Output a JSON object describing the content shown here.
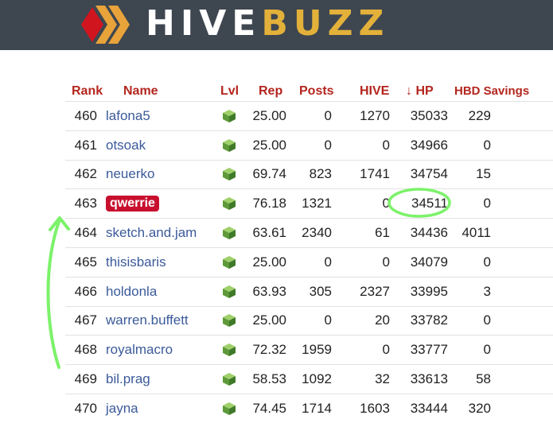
{
  "brand": {
    "part1": "HIVE",
    "part2": "BUZZ"
  },
  "columns": {
    "rank": "Rank",
    "name": "Name",
    "lvl": "Lvl",
    "rep": "Rep",
    "posts": "Posts",
    "hive": "HIVE",
    "sort_arrow": "↓",
    "hp": "HP",
    "hbd_savings": "HBD Savings"
  },
  "rows": [
    {
      "rank": "460",
      "name": "lafona5",
      "rep": "25.00",
      "posts": "0",
      "hive": "1270",
      "hp": "35033",
      "hbd": "229"
    },
    {
      "rank": "461",
      "name": "otsoak",
      "rep": "25.00",
      "posts": "0",
      "hive": "0",
      "hp": "34966",
      "hbd": "0"
    },
    {
      "rank": "462",
      "name": "neuerko",
      "rep": "69.74",
      "posts": "823",
      "hive": "1741",
      "hp": "34754",
      "hbd": "15"
    },
    {
      "rank": "463",
      "name": "qwerrie",
      "rep": "76.18",
      "posts": "1321",
      "hive": "0",
      "hp": "34511",
      "hbd": "0",
      "highlighted": true
    },
    {
      "rank": "464",
      "name": "sketch.and.jam",
      "rep": "63.61",
      "posts": "2340",
      "hive": "61",
      "hp": "34436",
      "hbd": "4011"
    },
    {
      "rank": "465",
      "name": "thisisbaris",
      "rep": "25.00",
      "posts": "0",
      "hive": "0",
      "hp": "34079",
      "hbd": "0"
    },
    {
      "rank": "466",
      "name": "holdonla",
      "rep": "63.93",
      "posts": "305",
      "hive": "2327",
      "hp": "33995",
      "hbd": "3"
    },
    {
      "rank": "467",
      "name": "warren.buffett",
      "rep": "25.00",
      "posts": "0",
      "hive": "20",
      "hp": "33782",
      "hbd": "0"
    },
    {
      "rank": "468",
      "name": "royalmacro",
      "rep": "72.32",
      "posts": "1959",
      "hive": "0",
      "hp": "33777",
      "hbd": "0"
    },
    {
      "rank": "469",
      "name": "bil.prag",
      "rep": "58.53",
      "posts": "1092",
      "hive": "32",
      "hp": "33613",
      "hbd": "58"
    },
    {
      "rank": "470",
      "name": "jayna",
      "rep": "74.45",
      "posts": "1714",
      "hive": "1603",
      "hp": "33444",
      "hbd": "320"
    }
  ],
  "icons": {
    "level": "green-cube-level-icon",
    "logo": "hive-logo-icon"
  },
  "colors": {
    "header_bg": "#3e4650",
    "column_header": "#b3261e",
    "name_link": "#3b5a9a",
    "highlight_badge": "#c8102e",
    "annotation": "#7cf26a",
    "logo_red": "#d1151f",
    "logo_orange": "#e8a33a"
  }
}
